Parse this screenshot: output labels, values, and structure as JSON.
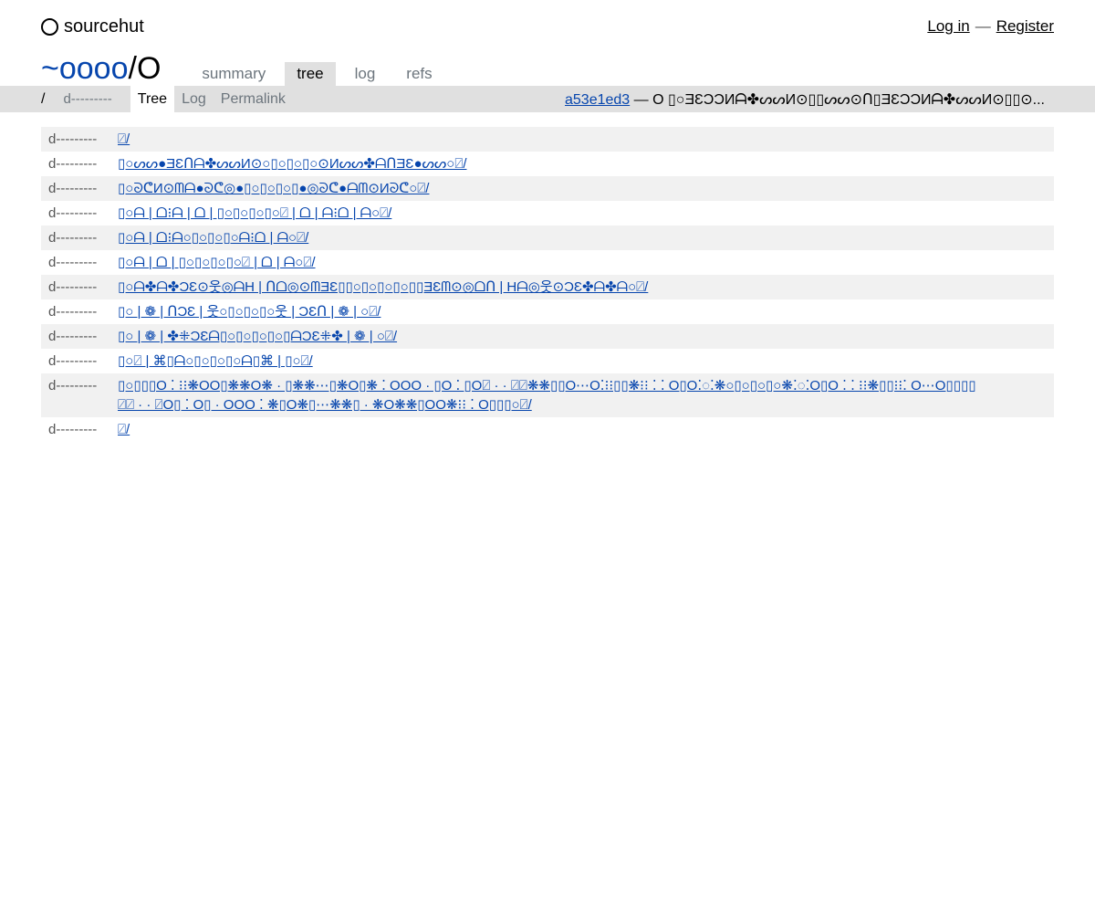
{
  "site": {
    "brand": "sourcehut",
    "login": "Log in",
    "separator": "—",
    "register": "Register"
  },
  "repo": {
    "owner": "~oooo",
    "slash": "/",
    "name": "O"
  },
  "tabs": [
    {
      "label": "summary"
    },
    {
      "label": "tree"
    },
    {
      "label": "log"
    },
    {
      "label": "refs"
    }
  ],
  "pathbar": {
    "root": "/",
    "mode": "d---------",
    "subtabs": [
      {
        "label": "Tree"
      },
      {
        "label": "Log"
      },
      {
        "label": "Permalink"
      }
    ],
    "commit_hash": "a53e1ed3",
    "commit_message": "— O ▯○ƎƐƆƆИᗩ✤ᔕᔕИ⊙▯▯ᔕᔕ⊙ᑎ▯ƎƐƆƆИᗩ✤ᔕᔕИ⊙▯▯⊙..."
  },
  "entries": [
    {
      "mode": "d---------",
      "name": "⍁/"
    },
    {
      "mode": "d---------",
      "name": "▯○ᔕᔕ●ƎƐᑎᗩ✤ᔕᔕИ⊙○▯○▯○▯○⊙Иᔕᔕ✤ᗩᑎƎƐ●ᔕᔕ○⍁/"
    },
    {
      "mode": "d---------",
      "name": "▯○ᘐᕦИ⊙ᗰᗩ●ᘐᕦ◎●▯○▯○▯○▯●◎ᘐᕦ●ᗩᗰ⊙Иᘐᕦ○⍁/"
    },
    {
      "mode": "d---------",
      "name": "▯○ᗩ | ᗝ⁝ᗩ | ᗝ | ▯○▯○▯○▯○⍁ | ᗝ | ᗩ⁝ᗝ | ᗩ○⍁/"
    },
    {
      "mode": "d---------",
      "name": "▯○ᗩ | ᗝ⁝ᗩ○▯○▯○▯○ᗩ⁝ᗝ | ᗩ○⍁/"
    },
    {
      "mode": "d---------",
      "name": "▯○ᗩ | ᗝ | ▯○▯○▯○▯○⍁ | ᗝ | ᗩ○⍁/"
    },
    {
      "mode": "d---------",
      "name": "▯○ᗩ✤ᗩ✤ƆƐ⊙웃◎ᗩH | ᑎᗝ◎⊙ᗰƎƐ▯▯○▯○▯○▯○▯▯ƎƐᗰ⊙◎ᗝᑎ | Hᗩ◎웃⊙ƆƐ✤ᗩ✤ᗩ○⍁/"
    },
    {
      "mode": "d---------",
      "name": "▯○ | ❁ | ᑎƆƐ | 웃○▯○▯○▯○웃 | ƆƐᑎ | ❁ | ○⍁/"
    },
    {
      "mode": "d---------",
      "name": "▯○ | ❁ | ✤⁜ƆƐᗩ▯○▯○▯○▯○▯ᗩƆƐ⁜✤ | ❁ | ○⍁/"
    },
    {
      "mode": "d---------",
      "name": "▯○⍁ | ⌘▯ᗩ○▯○▯○▯○ᗩ▯⌘ | ▯○⍁/"
    },
    {
      "mode": "d---------",
      "name": "▯○▯▯▯O ⁚ ⁝⁝❋OO▯❋❋O❋ · ▯❋❋⋯▯❋O▯❋ ⁚ OOO · ▯O ⁚ ▯O⍁ · · ⍁⍁❋❋▯▯O⋯O⁚⁝⁝▯▯❋⁝⁝ ⁚ ⁚ O▯O⁚◌⁚❋○▯○▯○▯○❋⁚◌⁚O▯O ⁚ ⁚ ⁝⁝❋▯▯⁝⁝⁚ O⋯O▯▯▯▯⍁⍁ · · ⍁O▯ ⁚ O▯ · OOO ⁚ ❋▯O❋▯⋯❋❋▯ · ❋O❋❋▯OO❋⁝⁝ ⁚ O▯▯▯○⍁/"
    },
    {
      "mode": "d---------",
      "name": "⍁/"
    }
  ]
}
